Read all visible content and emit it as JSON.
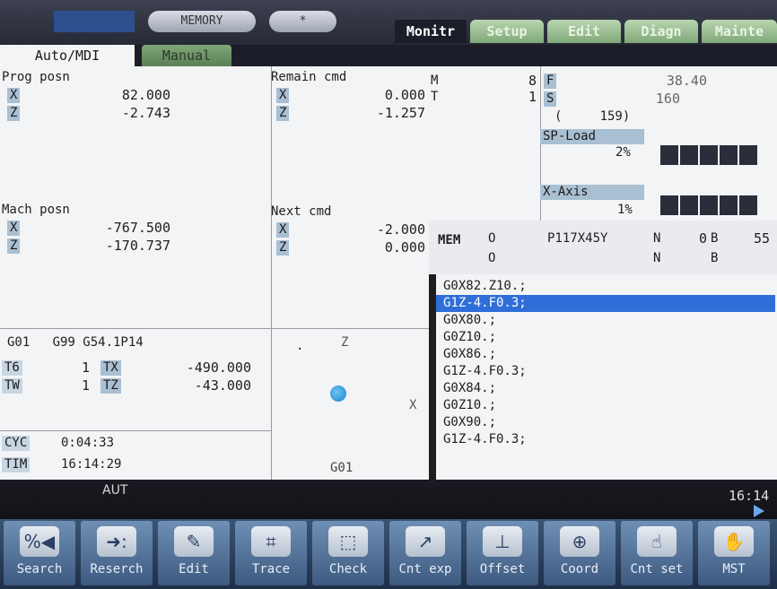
{
  "top": {
    "pill_memory": "MEMORY",
    "pill_small": "*",
    "tabs": [
      "Monitr",
      "Setup",
      "Edit",
      "Diagn",
      "Mainte"
    ],
    "mode_tabs": [
      "Auto/MDI",
      "Manual"
    ]
  },
  "prog_posn": {
    "title": "Prog posn",
    "x_label": "X",
    "x_value": "82.000",
    "z_label": "Z",
    "z_value": "-2.743"
  },
  "remain_cmd": {
    "title": "Remain cmd",
    "x_label": "X",
    "x_value": "0.000",
    "z_label": "Z",
    "z_value": "-1.257"
  },
  "mach_posn": {
    "title": "Mach posn",
    "x_label": "X",
    "x_value": "-767.500",
    "z_label": "Z",
    "z_value": "-170.737"
  },
  "next_cmd": {
    "title": "Next cmd",
    "x_label": "X",
    "x_value": "-2.000",
    "z_label": "Z",
    "z_value": "0.000"
  },
  "mt": {
    "m_label": "M",
    "m_value": "8",
    "t_label": "T",
    "t_value": "1"
  },
  "fs": {
    "f_label": "F",
    "f_value": "38.40",
    "s_label": "S",
    "s_value": "160",
    "s_paren": "(     159)"
  },
  "load": {
    "sp_label": "SP-Load",
    "sp_value": "2%",
    "sp_level": 0.02,
    "x_label": "X-Axis",
    "x_value": "1%",
    "x_level": 0.01
  },
  "gcodes": {
    "modal": "G01   G99 G54.1P14"
  },
  "tool": {
    "t6_label": "T6",
    "t6_value": "1",
    "tx_label": "TX",
    "tx_value": "-490.000",
    "tw_label": "TW",
    "tw_value": "1",
    "tz_label": "TZ",
    "tz_value": "-43.000"
  },
  "times": {
    "cyc_label": "CYC",
    "cyc_value": "0:04:33",
    "tim_label": "TIM",
    "tim_value": "16:14:29"
  },
  "graph": {
    "z_axis": "Z",
    "x_axis": "X",
    "gmode": "G01",
    "dot": "."
  },
  "mem": {
    "mode": "MEM",
    "o1": "O",
    "o2": "O",
    "prog_name": "P117X45Y",
    "n_label": "N",
    "n_value": "0",
    "n_label2": "N",
    "b_label": "B",
    "b_value": "55",
    "b_label2": "B"
  },
  "program_lines": [
    "G0X82.Z10.;",
    "G1Z-4.F0.3;",
    "G0X80.;",
    "G0Z10.;",
    "G0X86.;",
    "G1Z-4.F0.3;",
    "G0X84.;",
    "G0Z10.;",
    "G0X90.;",
    "G1Z-4.F0.3;"
  ],
  "selected_line": 1,
  "status": {
    "mode": "AUT",
    "clock": "16:14"
  },
  "softkeys": [
    {
      "label": "Search",
      "icon": "search-icon",
      "glyph": "%◀"
    },
    {
      "label": "Reserch",
      "icon": "research-icon",
      "glyph": "➜:"
    },
    {
      "label": "Edit",
      "icon": "edit-icon",
      "glyph": "✎"
    },
    {
      "label": "Trace",
      "icon": "trace-icon",
      "glyph": "⌗"
    },
    {
      "label": "Check",
      "icon": "check-icon",
      "glyph": "⬚"
    },
    {
      "label": "Cnt exp",
      "icon": "cnt-exp-icon",
      "glyph": "↗"
    },
    {
      "label": "Offset",
      "icon": "offset-icon",
      "glyph": "⊥"
    },
    {
      "label": "Coord",
      "icon": "coord-icon",
      "glyph": "⊕"
    },
    {
      "label": "Cnt set",
      "icon": "cnt-set-icon",
      "glyph": "☝"
    },
    {
      "label": "MST",
      "icon": "mst-icon",
      "glyph": "✋"
    }
  ],
  "colors": {
    "selection": "#2f6ed8",
    "label_bg": "#a9bfd2",
    "tab_green": "#7fa878"
  }
}
